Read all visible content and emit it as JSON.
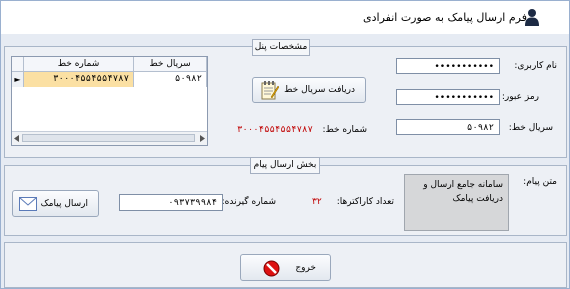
{
  "window": {
    "title": "فرم ارسال پیامک به صورت انفرادی",
    "user_icon": "user-icon"
  },
  "panel": {
    "legend": "مشخصات پنل",
    "username_label": "نام کاربری:",
    "username_value": "•••••••••••",
    "password_label": "رمز عبور:",
    "password_value": "•••••••••••",
    "serial_label": "سریال خط:",
    "serial_value": "۵۰۹۸۲",
    "get_serial_button": "دریافت سریال خط",
    "line_number_label": "شماره خط:",
    "line_number_value": "۳۰۰۰۴۵۵۴۵۵۴۷۸۷",
    "grid": {
      "columns": [
        "سریال خط",
        "شماره خط"
      ],
      "rows": [
        {
          "serial": "۵۰۹۸۲",
          "number": "۳۰۰۰۴۵۵۴۵۵۴۷۸۷"
        }
      ]
    }
  },
  "message": {
    "legend": "بخش ارسال پیام",
    "text_label": "متن پیام:",
    "text_value": "سامانه جامع ارسال و دریافت پیامک",
    "char_count_label": "تعداد کاراکترها:",
    "char_count_value": "۳۲",
    "recipient_label": "شماره گیرنده:",
    "recipient_value": "۰۹۳۷۳۹۹۸۴",
    "send_button": "ارسال پیامک"
  },
  "footer": {
    "exit_button": "خروج"
  },
  "colors": {
    "accent_red": "#c00000",
    "row_selected": "#fbe0a3"
  }
}
